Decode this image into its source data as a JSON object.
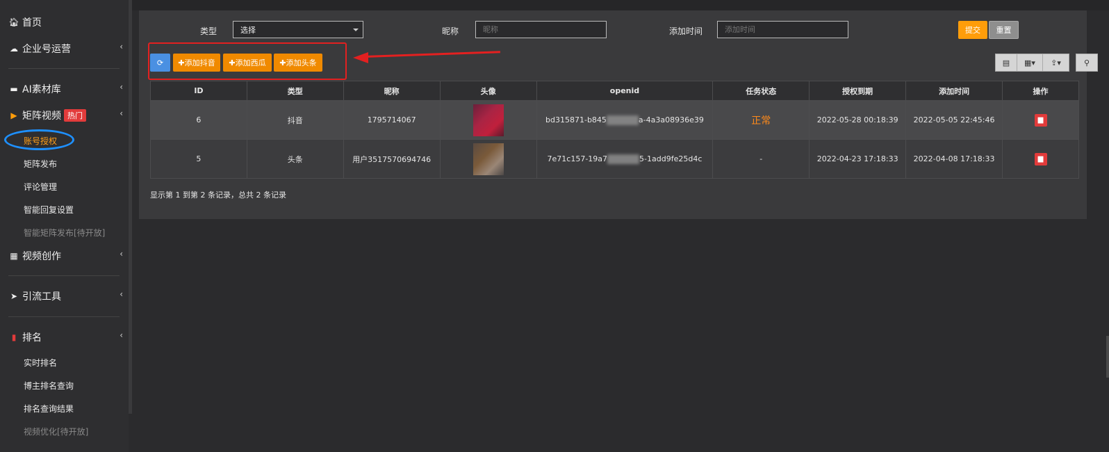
{
  "sidebar": {
    "home": "首页",
    "enterprise": "企业号运营",
    "ai_material": "AI素材库",
    "matrix_video": "矩阵视频",
    "hot_badge": "热门",
    "matrix_sub": [
      "账号授权",
      "矩阵发布",
      "评论管理",
      "智能回复设置",
      "智能矩阵发布[待开放]"
    ],
    "video_create": "视频创作",
    "traffic_tool": "引流工具",
    "ranking": "排名",
    "ranking_sub": [
      "实时排名",
      "博主排名查询",
      "排名查询结果",
      "视频优化[待开放]"
    ]
  },
  "filters": {
    "type_label": "类型",
    "type_value": "选择",
    "nickname_label": "昵称",
    "nickname_placeholder": "昵称",
    "addtime_label": "添加时间",
    "addtime_placeholder": "添加时间",
    "submit": "提交",
    "reset": "重置"
  },
  "toolbar": {
    "refresh_icon": "refresh-icon",
    "add_douyin": "✚添加抖音",
    "add_xigua": "✚添加西瓜",
    "add_toutiao": "✚添加头条"
  },
  "table": {
    "headers": [
      "ID",
      "类型",
      "昵称",
      "头像",
      "openid",
      "任务状态",
      "授权到期",
      "添加时间",
      "操作"
    ],
    "rows": [
      {
        "id": "6",
        "type": "抖音",
        "nickname": "1795714067",
        "openid_a": "bd315871-b845",
        "openid_b": "a-4a3a08936e39",
        "status": "正常",
        "expire": "2022-05-28 00:18:39",
        "added": "2022-05-05 22:45:46"
      },
      {
        "id": "5",
        "type": "头条",
        "nickname": "用户3517570694746",
        "openid_a": "7e71c157-19a7",
        "openid_b": "5-1add9fe25d4c",
        "status": "-",
        "expire": "2022-04-23 17:18:33",
        "added": "2022-04-08 17:18:33"
      }
    ]
  },
  "pager": {
    "info": "显示第 1 到第 2 条记录，总共 2 条记录"
  },
  "colors": {
    "accent": "#ff9d0a",
    "danger": "#e23b3b",
    "annotation": "#e32020",
    "highlight_circle": "#1e90ff"
  }
}
